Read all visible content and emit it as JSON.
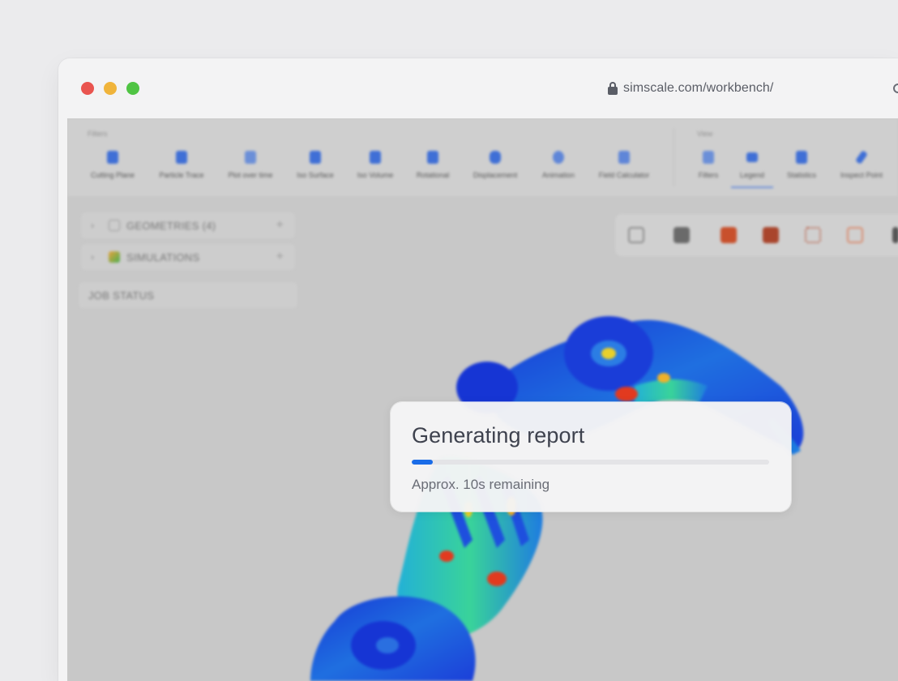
{
  "browser": {
    "url": "simscale.com/workbench/",
    "traffic_lights": [
      "close",
      "minimize",
      "zoom"
    ]
  },
  "toolbar": {
    "filters_label": "Filters",
    "view_label": "View",
    "filters": [
      {
        "label": "Cutting Plane",
        "icon": "cutting-plane-icon"
      },
      {
        "label": "Particle Trace",
        "icon": "particle-trace-icon"
      },
      {
        "label": "Plot over time",
        "icon": "plot-icon"
      },
      {
        "label": "Iso Surface",
        "icon": "iso-surface-icon"
      },
      {
        "label": "Iso Volume",
        "icon": "iso-volume-icon"
      },
      {
        "label": "Rotational",
        "icon": "rotational-icon"
      },
      {
        "label": "Displacement",
        "icon": "displacement-icon"
      },
      {
        "label": "Animation",
        "icon": "play-icon"
      },
      {
        "label": "Field Calculator",
        "icon": "calculator-icon"
      }
    ],
    "view": [
      {
        "label": "Filters",
        "icon": "filters-icon"
      },
      {
        "label": "Legend",
        "icon": "legend-icon",
        "active": true
      },
      {
        "label": "Statistics",
        "icon": "statistics-icon"
      },
      {
        "label": "Inspect Point",
        "icon": "inspect-point-icon"
      }
    ]
  },
  "sidebar": {
    "geometries": "GEOMETRIES (4)",
    "simulations": "SIMULATIONS",
    "job_status": "JOB STATUS"
  },
  "dialog": {
    "title": "Generating report",
    "progress": 0.06,
    "remaining": "Approx. 10s remaining",
    "accent": "#1a6ce8"
  }
}
